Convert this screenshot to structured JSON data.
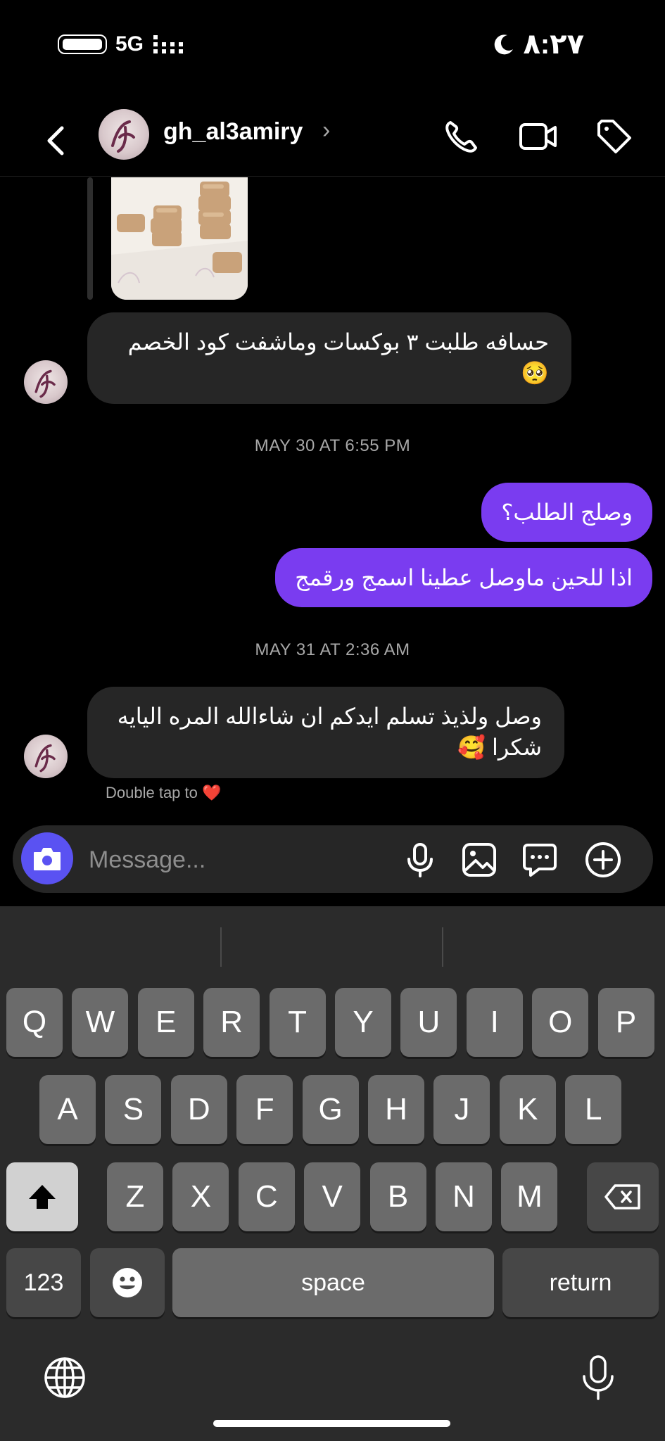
{
  "status_bar": {
    "network": "5G",
    "time": "٨:٢٧"
  },
  "header": {
    "username": "gh_al3amiry",
    "chevron": "›"
  },
  "messages": [
    {
      "text": "حسافه طلبت ٣ بوكسات وماشفت كود الخصم 🥺"
    },
    {
      "timestamp": "MAY 30 AT 6:55 PM"
    },
    {
      "text": "وصلج الطلب؟"
    },
    {
      "text": "اذا للحين ماوصل عطينا اسمج ورقمج"
    },
    {
      "timestamp": "MAY 31 AT 2:36 AM"
    },
    {
      "text": "وصل ولذيذ تسلم ايدكم ان شاءالله المره اليايه شكرا 🥰"
    }
  ],
  "reaction_hint": "Double tap to ❤️",
  "composer": {
    "placeholder": "Message..."
  },
  "keyboard": {
    "row1": [
      "Q",
      "W",
      "E",
      "R",
      "T",
      "Y",
      "U",
      "I",
      "O",
      "P"
    ],
    "row2": [
      "A",
      "S",
      "D",
      "F",
      "G",
      "H",
      "J",
      "K",
      "L"
    ],
    "row3": [
      "Z",
      "X",
      "C",
      "V",
      "B",
      "N",
      "M"
    ],
    "numbers": "123",
    "space": "space",
    "return": "return"
  },
  "colors": {
    "outgoing_bubble": "#7a3cf0",
    "incoming_bubble": "#262626",
    "camera_button": "#5a52f2"
  }
}
